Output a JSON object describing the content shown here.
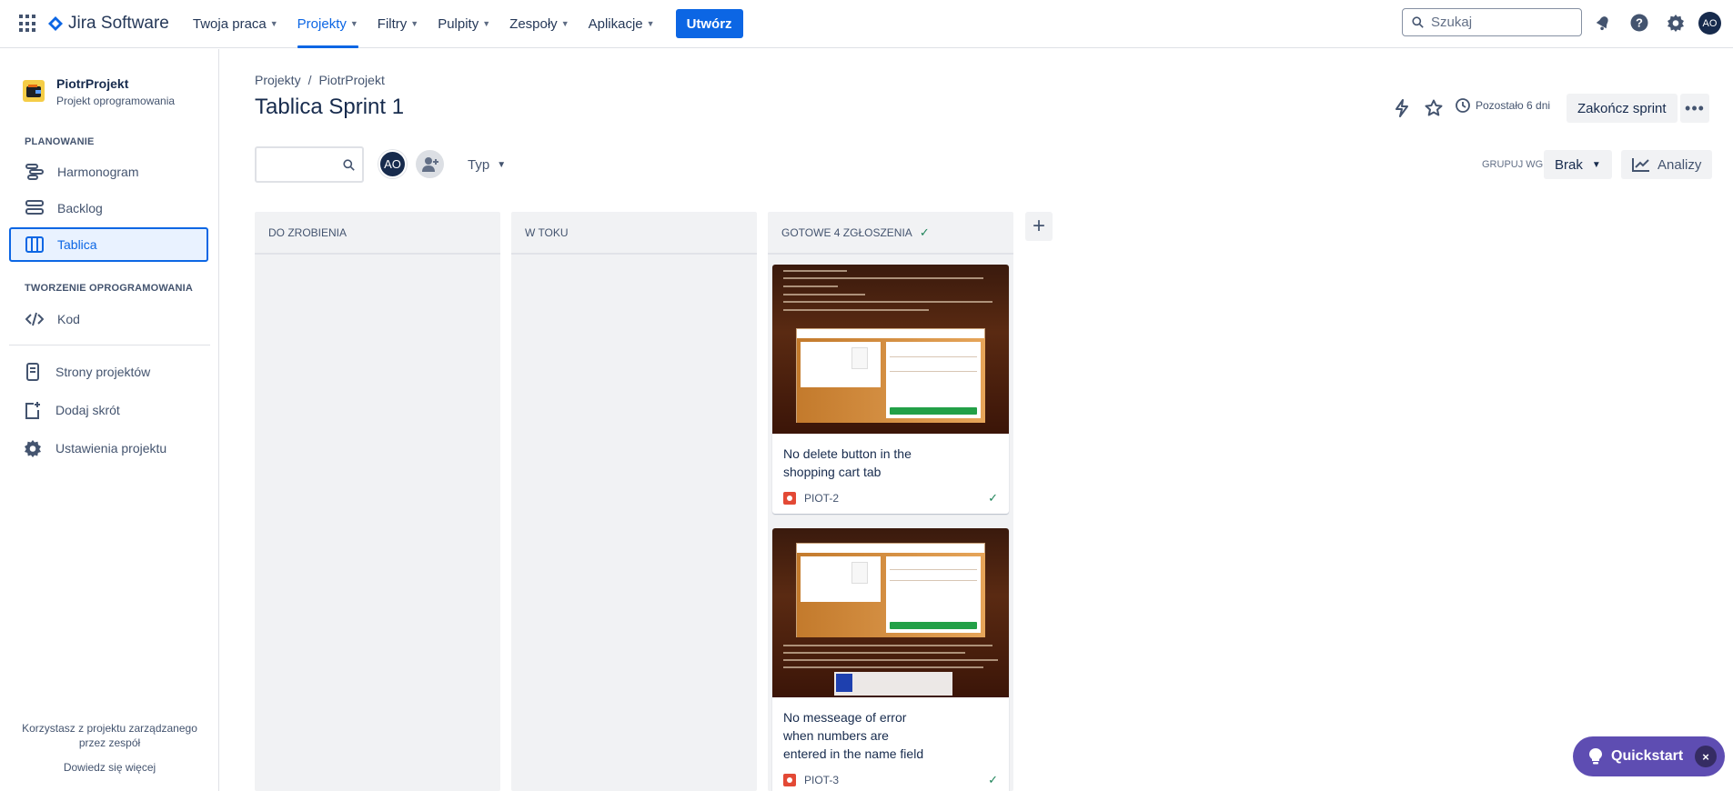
{
  "topnav": {
    "brand": "Jira Software",
    "items": [
      {
        "label": "Twoja praca",
        "active": false
      },
      {
        "label": "Projekty",
        "active": true
      },
      {
        "label": "Filtry",
        "active": false
      },
      {
        "label": "Pulpity",
        "active": false
      },
      {
        "label": "Zespoły",
        "active": false
      },
      {
        "label": "Aplikacje",
        "active": false
      }
    ],
    "create_label": "Utwórz",
    "search_placeholder": "Szukaj",
    "avatar_initials": "AO",
    "icons": [
      "app-switcher-icon",
      "notifications-icon",
      "help-icon",
      "settings-icon"
    ]
  },
  "sidebar": {
    "project_name": "PiotrProjekt",
    "project_type": "Projekt oprogramowania",
    "section_planning": "PLANOWANIE",
    "planning_items": [
      {
        "label": "Harmonogram",
        "icon": "timeline-icon"
      },
      {
        "label": "Backlog",
        "icon": "backlog-icon"
      },
      {
        "label": "Tablica",
        "icon": "board-icon",
        "active": true
      }
    ],
    "section_dev": "TWORZENIE OPROGRAMOWANIA",
    "dev_items": [
      {
        "label": "Kod",
        "icon": "code-icon"
      }
    ],
    "other_items": [
      {
        "label": "Strony projektów",
        "icon": "pages-icon"
      },
      {
        "label": "Dodaj skrót",
        "icon": "add-shortcut-icon"
      },
      {
        "label": "Ustawienia projektu",
        "icon": "settings-icon"
      }
    ],
    "footer_text": "Korzystasz z projektu zarządzanego przez zespół",
    "footer_link": "Dowiedz się więcej"
  },
  "header": {
    "breadcrumb": [
      "Projekty",
      "PiotrProjekt"
    ],
    "title": "Tablica Sprint 1",
    "remaining": "Pozostało 6 dni",
    "end_sprint": "Zakończ sprint",
    "more": "•••"
  },
  "filters": {
    "avatar_initials": "AO",
    "type_label": "Typ",
    "group_by_label": "GRUPUJ WG",
    "group_by_value": "Brak",
    "insights_label": "Analizy"
  },
  "columns": [
    {
      "title": "DO ZROBIENIA",
      "done": false
    },
    {
      "title": "W TOKU",
      "done": false
    },
    {
      "title": "GOTOWE 4 ZGŁOSZENIA",
      "done": true
    }
  ],
  "cards": [
    {
      "title": "No delete button in the shopping cart tab",
      "key": "PIOT-2",
      "type": "bug",
      "done": true
    },
    {
      "title": "No messeage of error when numbers are entered in the name field",
      "key": "PIOT-3",
      "type": "bug",
      "done": true
    }
  ],
  "quickstart": {
    "label": "Quickstart",
    "close": "×"
  },
  "colors": {
    "accent": "#0c66e4",
    "quickstart": "#5e4db2",
    "done": "#1f845a",
    "bug": "#e34935"
  }
}
